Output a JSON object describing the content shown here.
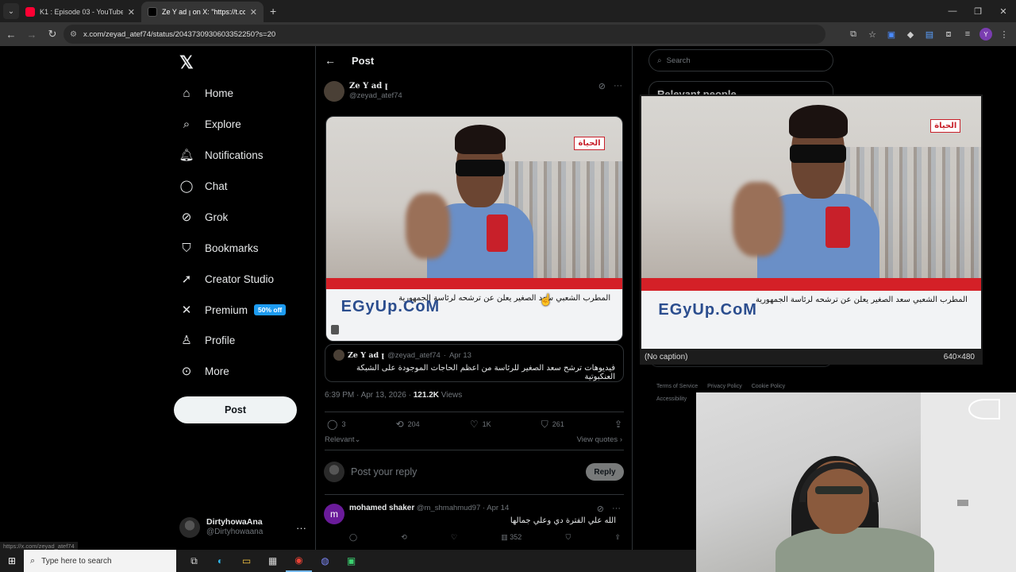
{
  "browser": {
    "tabs": [
      {
        "title": "K1 : Episode 03 - YouTube",
        "favicon_color": "#ff0033",
        "active": false
      },
      {
        "title": "Ze Y ad ꞁ on X: \"https://t.co/Tyc",
        "favicon_color": "#000000",
        "active": true
      }
    ],
    "address": "x.com/zeyad_atef74/status/2043730930603352250?s=20",
    "status_url": "https://x.com/zeyad_atef74"
  },
  "sidebar": {
    "nav": [
      {
        "label": "Home",
        "icon": "home-icon"
      },
      {
        "label": "Explore",
        "icon": "search-icon"
      },
      {
        "label": "Notifications",
        "icon": "bell-icon"
      },
      {
        "label": "Chat",
        "icon": "chat-icon"
      },
      {
        "label": "Grok",
        "icon": "grok-icon"
      },
      {
        "label": "Bookmarks",
        "icon": "bookmark-icon"
      },
      {
        "label": "Creator Studio",
        "icon": "rocket-icon"
      },
      {
        "label": "Premium",
        "icon": "x-icon"
      },
      {
        "label": "Profile",
        "icon": "person-icon"
      },
      {
        "label": "More",
        "icon": "more-circle-icon"
      }
    ],
    "premium_badge": "50% off",
    "post_label": "Post",
    "account": {
      "name": "DirtyhowaAna",
      "handle": "@Dirtyhowaana"
    }
  },
  "post": {
    "header": "Post",
    "author_name": "Ze Y ad ꞁ",
    "author_handle": "@zeyad_atef74",
    "video": {
      "channel_logo": "الحياة",
      "caption": "المطرب الشعبي سعد الصغير يعلن عن ترشحه لرئاسة الجمهورية",
      "watermark": "EGyUp.CoM"
    },
    "quote": {
      "name": "Ze Y ad ꞁ",
      "handle": "@zeyad_atef74",
      "date": "Apr 13",
      "text": "فيديوهات ترشح سعد الصغير للرئاسة من اعظم الحاجات الموجودة على الشبكة العنكبوتية"
    },
    "time": "6:39 PM · Apr 13, 2026 · ",
    "views_count": "121.2K",
    "views_label": " Views",
    "stats": {
      "replies": "3",
      "reposts": "204",
      "likes": "1K",
      "bookmarks": "261"
    },
    "sort_label": "Relevant",
    "view_quotes": "View quotes"
  },
  "reply_box": {
    "placeholder": "Post your reply",
    "button": "Reply"
  },
  "reply": {
    "avatar_letter": "m",
    "name": "mohamed shaker",
    "handle": "@m_shmahmud97",
    "date": "Apr 14",
    "text": "الله علي الفترة دي وعلي جمالها",
    "views": "352"
  },
  "right": {
    "search_placeholder": "Search",
    "relevant_title": "Relevant people",
    "footer": [
      "Terms of Service",
      "Privacy Policy",
      "Cookie Policy",
      "Accessibility"
    ]
  },
  "preview": {
    "caption": "(No caption)",
    "size": "640×480"
  },
  "taskbar": {
    "search_placeholder": "Type here to search"
  }
}
